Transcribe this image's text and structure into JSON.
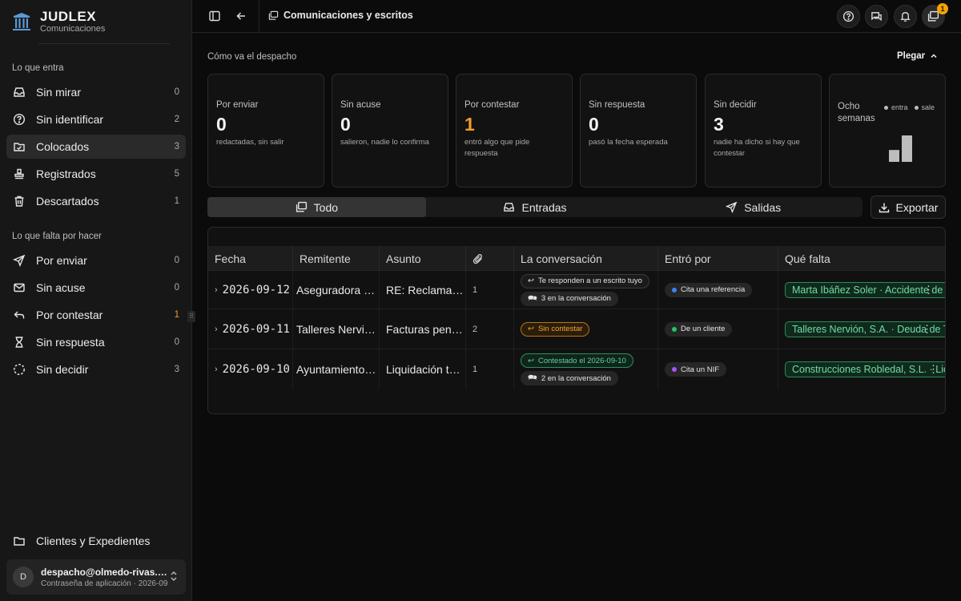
{
  "brand": {
    "name": "JUDLEX",
    "subtitle": "Comunicaciones"
  },
  "sidebar": {
    "section_in": "Lo que entra",
    "items_in": [
      {
        "label": "Sin mirar",
        "count": "0",
        "icon": "inbox-icon"
      },
      {
        "label": "Sin identificar",
        "count": "2",
        "icon": "question-icon"
      },
      {
        "label": "Colocados",
        "count": "3",
        "icon": "folder-icon",
        "active": true
      },
      {
        "label": "Registrados",
        "count": "5",
        "icon": "stamp-icon"
      },
      {
        "label": "Descartados",
        "count": "1",
        "icon": "trash-icon"
      }
    ],
    "section_todo": "Lo que falta por hacer",
    "items_todo": [
      {
        "label": "Por enviar",
        "count": "0",
        "icon": "send-icon"
      },
      {
        "label": "Sin acuse",
        "count": "0",
        "icon": "mail-icon"
      },
      {
        "label": "Por contestar",
        "count": "1",
        "icon": "reply-icon",
        "hot": true
      },
      {
        "label": "Sin respuesta",
        "count": "0",
        "icon": "hourglass-icon"
      },
      {
        "label": "Sin decidir",
        "count": "3",
        "icon": "dashed-circle-icon"
      }
    ],
    "bottom_link": "Clientes y Expedientes",
    "account": {
      "avatar": "D",
      "email": "despacho@olmedo-rivas.es",
      "subtitle": "Contraseña de aplicación · 2026-09"
    }
  },
  "topbar": {
    "title": "Comunicaciones y escritos",
    "notifications_count": "1"
  },
  "overview": {
    "title": "Cómo va el despacho",
    "collapse_label": "Plegar",
    "stats": [
      {
        "label": "Por enviar",
        "value": "0",
        "desc": "redactadas, sin salir"
      },
      {
        "label": "Sin acuse",
        "value": "0",
        "desc": "salieron, nadie lo confirma"
      },
      {
        "label": "Por contestar",
        "value": "1",
        "desc": "entró algo que pide respuesta",
        "hot": true
      },
      {
        "label": "Sin respuesta",
        "value": "0",
        "desc": "pasó la fecha esperada"
      },
      {
        "label": "Sin decidir",
        "value": "3",
        "desc": "nadie ha dicho si hay que contestar"
      }
    ],
    "weeks": {
      "label": "Ocho semanas",
      "legend_in": "entra",
      "legend_out": "sale",
      "bars": [
        0.45,
        1.0
      ],
      "bar_color": "#bcbcbc"
    }
  },
  "tabs": [
    {
      "label": "Todo",
      "icon": "stack-icon",
      "active": true
    },
    {
      "label": "Entradas",
      "icon": "inbox-icon"
    },
    {
      "label": "Salidas",
      "icon": "send-icon"
    }
  ],
  "export_label": "Exportar",
  "table": {
    "columns": [
      "Fecha",
      "Remitente",
      "Asunto",
      "attach-icon",
      "La conversación",
      "Entró por",
      "Qué falta"
    ],
    "rows": [
      {
        "date": "2026-09-12",
        "sender": "Aseguradora Levante",
        "subject": "RE: Reclamación",
        "attachments": "1",
        "conv": [
          {
            "text": "Te responden a un escrito tuyo",
            "style": "",
            "icon": "reply"
          },
          {
            "text": "3 en la conversación",
            "style": "grey",
            "icon": "chat"
          }
        ],
        "via": {
          "text": "Cita una referencia",
          "color": "#3b82f6"
        },
        "client": "Marta Ibáñez Soler · Accidente de tráfico"
      },
      {
        "date": "2026-09-11",
        "sender": "Talleres Nervión, S.A.",
        "subject": "Facturas pendientes",
        "attachments": "2",
        "conv": [
          {
            "text": "Sin contestar",
            "style": "orange",
            "icon": "reply"
          }
        ],
        "via": {
          "text": "De un cliente",
          "color": "#22c55e"
        },
        "client": "Talleres Nervión, S.A. · Deuda de Transportes"
      },
      {
        "date": "2026-09-10",
        "sender": "Ayuntamiento de Sevilla",
        "subject": "Liquidación tasa",
        "attachments": "1",
        "conv": [
          {
            "text": "Contestado el 2026-09-10",
            "style": "green",
            "icon": "reply"
          },
          {
            "text": "2 en la conversación",
            "style": "grey",
            "icon": "chat"
          }
        ],
        "via": {
          "text": "Cita un NIF",
          "color": "#a855f7"
        },
        "client": "Construcciones Robledal, S.L. · Licencia"
      }
    ]
  }
}
